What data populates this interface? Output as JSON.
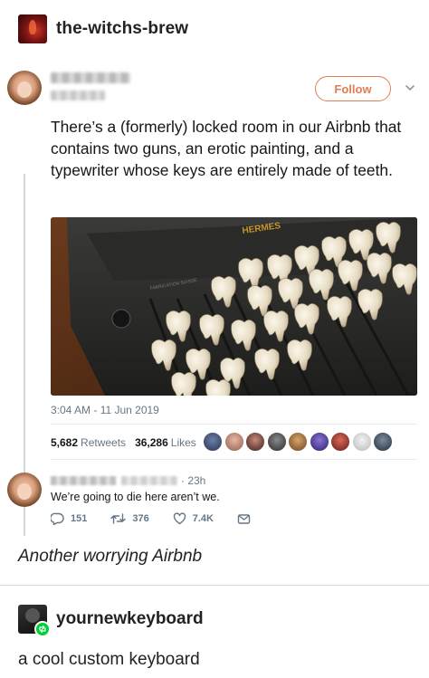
{
  "post": {
    "blog_name": "the-witchs-brew"
  },
  "tweet": {
    "follow_label": "Follow",
    "text": "There’s a (formerly) locked room in our Airbnb that contains two guns, an erotic painting, and a typewriter whose keys are entirely made of teeth.",
    "photo_brand": "HERMES",
    "photo_label": "FABRICATION SUISSE",
    "timestamp": "3:04 AM - 11 Jun 2019",
    "retweets_count": "5,682",
    "retweets_label": "Retweets",
    "likes_count": "36,286",
    "likes_label": "Likes"
  },
  "reply": {
    "time": "· 23h",
    "text": "We’re going to die here aren’t we.",
    "replies": "151",
    "retweets": "376",
    "likes": "7.4K"
  },
  "caption1": "Another worrying Airbnb",
  "reblog": {
    "blog_name": "yournewkeyboard",
    "caption": "a cool custom keyboard"
  },
  "icons": {
    "follow_caret": "chevron-down-icon",
    "reply": "reply-icon",
    "retweet": "retweet-icon",
    "like": "heart-icon",
    "dm": "mail-icon",
    "reblog_badge": "reblog-icon"
  },
  "colors": {
    "follow_accent": "#e07e52",
    "muted_text": "#657786",
    "reblog_badge": "#00cf35"
  }
}
